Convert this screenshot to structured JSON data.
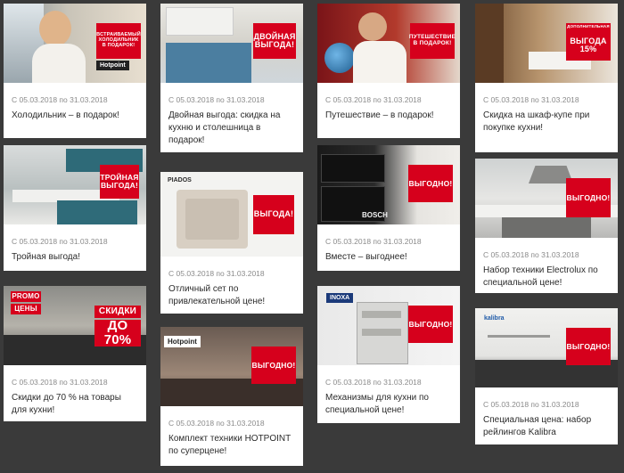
{
  "cards": [
    {
      "date": "С 05.03.2018 по 31.03.2018",
      "title": "Холодильник – в подарок!",
      "badge": "ВСТРАИВАЕМЫЙ ХОЛОДИЛЬНИК В ПОДАРОК!",
      "brand": "Hotpoint"
    },
    {
      "date": "С 05.03.2018 по 31.03.2018",
      "title": "Двойная выгода: скидка на кухню и столешница в подарок!",
      "badge": "ДВОЙНАЯ ВЫГОДА!"
    },
    {
      "date": "С 05.03.2018 по 31.03.2018",
      "title": "Путешествие – в подарок!",
      "badge": "ПУТЕШЕСТВИЕ В ПОДАРОК!"
    },
    {
      "date": "С 05.03.2018 по 31.03.2018",
      "title": "Скидка на шкаф-купе при покупке кухни!",
      "badge_small": "ДОПОЛНИТЕЛЬНАЯ",
      "badge": "ВЫГОДА 15%"
    },
    {
      "date": "С 05.03.2018 по 31.03.2018",
      "title": "Тройная выгода!",
      "badge": "ТРОЙНАЯ ВЫГОДА!"
    },
    {
      "date": "С 05.03.2018 по 31.03.2018",
      "title": "Отличный сет по привлекательной цене!",
      "badge": "ВЫГОДА!",
      "brand": "PIADOS"
    },
    {
      "date": "С 05.03.2018 по 31.03.2018",
      "title": "Вместе – выгоднее!",
      "badge": "ВЫГОДНО!",
      "brand": "BOSCH"
    },
    {
      "date": "С 05.03.2018 по 31.03.2018",
      "title": "Набор техники Electrolux по специальной цене!",
      "badge": "ВЫГОДНО!"
    },
    {
      "date": "С 05.03.2018 по 31.03.2018",
      "title": "Скидки до 70 % на товары для кухни!",
      "badge_small": "PROMO",
      "badge_small2": "ЦЕНЫ",
      "badge": "СКИДКИ",
      "badge_pct": "до 70%"
    },
    {
      "date": "С 05.03.2018 по 31.03.2018",
      "title": "Комплект техники HOTPOINT по суперцене!",
      "badge": "ВЫГОДНО!",
      "brand": "Hotpoint"
    },
    {
      "date": "С 05.03.2018 по 31.03.2018",
      "title": "Механизмы для кухни по специальной цене!",
      "badge": "ВЫГОДНО!",
      "brand": "INOXA"
    },
    {
      "date": "С 05.03.2018 по 31.03.2018",
      "title": "Специальная цена: набор рейлингов Kalibra",
      "badge": "ВЫГОДНО!",
      "brand": "kalibra"
    }
  ],
  "colors": {
    "page_bg": "#3a3a3a",
    "promo_red": "#d6001c",
    "date_text": "#8a8a8a",
    "title_text": "#2b2b2b"
  }
}
